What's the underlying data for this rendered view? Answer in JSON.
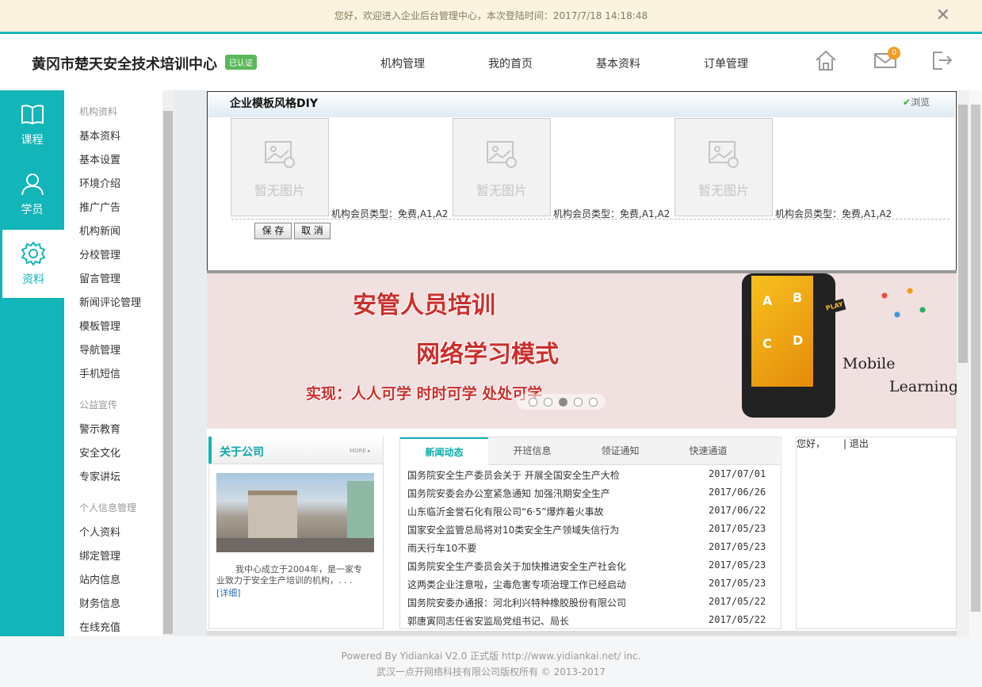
{
  "notice": {
    "text": "您好，欢迎进入企业后台管理中心，本次登陆时间：2017/7/18 14:18:48",
    "close": "✕"
  },
  "header": {
    "org_name": "黄冈市楚天安全技术培训中心",
    "badge": "已认证",
    "nav": [
      "机构管理",
      "我的首页",
      "基本资料",
      "订单管理"
    ],
    "mail_count": "0"
  },
  "leftnav": [
    {
      "label": "课程",
      "icon": "book-icon"
    },
    {
      "label": "学员",
      "icon": "user-icon"
    },
    {
      "label": "资料",
      "icon": "gear-icon",
      "active": true
    }
  ],
  "submenu": {
    "group1": "机构资料",
    "items1": [
      "基本资料",
      "基本设置",
      "环境介绍",
      "推广广告",
      "机构新闻",
      "分校管理",
      "留言管理",
      "新闻评论管理",
      "模板管理",
      "导航管理",
      "手机短信"
    ],
    "group2": "公益宣传",
    "items2": [
      "警示教育",
      "安全文化",
      "专家讲坛"
    ],
    "group3": "个人信息管理",
    "items3": [
      "个人资料",
      "绑定管理",
      "站内信息",
      "财务信息",
      "在线充值"
    ]
  },
  "diy": {
    "title": "企业模板风格DIY",
    "preview": "浏览",
    "no_image": "暂无图片",
    "member_types": [
      "机构会员类型：免费,A1,A2",
      "机构会员类型：免费,A1,A2",
      "机构会员类型：免费,A1,A2"
    ],
    "save": "保 存",
    "cancel": "取 消"
  },
  "banner": {
    "line1": "安管人员培训",
    "line2": "网络学习模式",
    "line3": "实现：人人可学 时时可学 处处可学",
    "mobile": "Mobile",
    "learning": "Learning",
    "phone_letters": [
      "A",
      "B",
      "C",
      "D"
    ],
    "play": "PLAY"
  },
  "about": {
    "title": "关于公司",
    "more": "MORE ▸",
    "text": "我中心成立于2004年，是一家专业致力于安全生产培训的机构，. . .",
    "link": "[详细]"
  },
  "news": {
    "tabs": [
      "新闻动态",
      "开班信息",
      "领证通知",
      "快速通道"
    ],
    "items": [
      {
        "title": "国务院安全生产委员会关于 开展全国安全生产大检",
        "date": "2017/07/01"
      },
      {
        "title": "国务院安委会办公室紧急通知 加强汛期安全生产",
        "date": "2017/06/26"
      },
      {
        "title": "山东临沂金誉石化有限公司“6·5”爆炸着火事故",
        "date": "2017/06/22"
      },
      {
        "title": "国家安全监管总局将对10类安全生产领域失信行为",
        "date": "2017/05/23"
      },
      {
        "title": "雨天行车10不要",
        "date": "2017/05/23"
      },
      {
        "title": "国务院安全生产委员会关于加快推进安全生产社会化",
        "date": "2017/05/23"
      },
      {
        "title": "这两类企业注意啦，尘毒危害专项治理工作已经启动",
        "date": "2017/05/23"
      },
      {
        "title": "国务院安委办通报：河北利兴特种橡胶股份有限公司",
        "date": "2017/05/22"
      },
      {
        "title": "郭唐寅同志任省安监局党组书记、局长",
        "date": "2017/05/22"
      }
    ]
  },
  "login": {
    "hello": "您好，",
    "logout": "| 退出"
  },
  "footer": {
    "line1": "Powered By Yidiankai V2.0 正式版 http://www.yidiankai.net/ inc.",
    "line2": "武汉一点开网络科技有限公司版权所有 © 2013-2017"
  },
  "colors": {
    "accent": "#12b5b8",
    "notice_bg": "#fbf3df",
    "banner_red": "#c9302c"
  }
}
